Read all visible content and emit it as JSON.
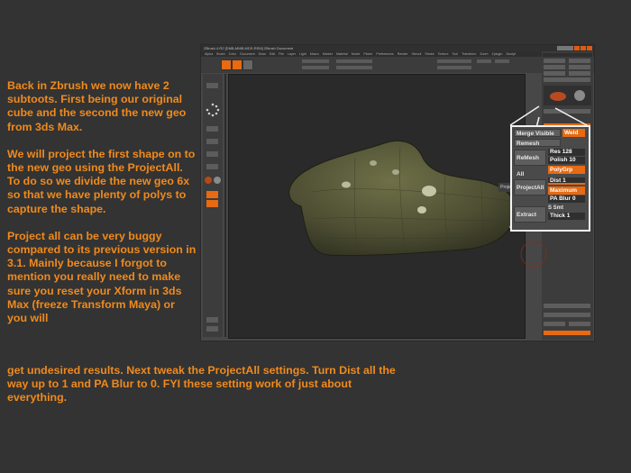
{
  "notes": {
    "para1": "Back in Zbrush we now have 2 subtoots. First being our original cube and the second the new geo from 3ds Max.",
    "para2": "We will project the first shape on to the new geo using the ProjectAll. To do so we divide the new geo 6x so that we have plenty of polys to capture the shape.",
    "para3": "Project all can be very buggy compared to its previous version in 3.1. Mainly because I forgot to mention you really need to make sure you reset your Xform in 3ds Max (freeze Transform Maya) or you will",
    "para4": "get undesired results.   Next tweak the ProjectAll settings. Turn Dist all the way up to 1 and PA Blur to 0. FYI these setting work of just about everything."
  },
  "app": {
    "title": "ZBrush 4.R2 [DMB-MMB-MDS-RSM] ZBrush Document",
    "menu": [
      "Alpha",
      "Brush",
      "Color",
      "Document",
      "Draw",
      "Edit",
      "File",
      "Layer",
      "Light",
      "Macro",
      "Marker",
      "Material",
      "Movie",
      "Picker",
      "Preferences",
      "Render",
      "Stencil",
      "Stroke",
      "Texture",
      "Tool",
      "Transform",
      "Zoom",
      "Zplugin",
      "Zscript"
    ],
    "projection_tag": "Proje"
  },
  "zoom_panel": {
    "merge_visible": "Merge Visible",
    "weld": "Weld",
    "remesh_label": "Remesh",
    "remesh_all": "ReMesh All",
    "res_label": "Res",
    "res_value": "128",
    "polish_label": "Polish",
    "polish_value": "10",
    "polygrp": "PolyGrp",
    "project_all": "ProjectAll",
    "dist_label": "Dist",
    "dist_value": "1",
    "maximum": "Maximum",
    "pa_blur_label": "PA Blur",
    "pa_blur_value": "0",
    "extract": "Extract",
    "s_smt": "S Smt",
    "thick_label": "Thick",
    "thick_value": "1",
    "dist_fraction": 1.0,
    "pa_blur_fraction": 0.0
  },
  "colors": {
    "accent": "#e86a12",
    "note_text": "#f08a1c",
    "background": "#333333"
  }
}
